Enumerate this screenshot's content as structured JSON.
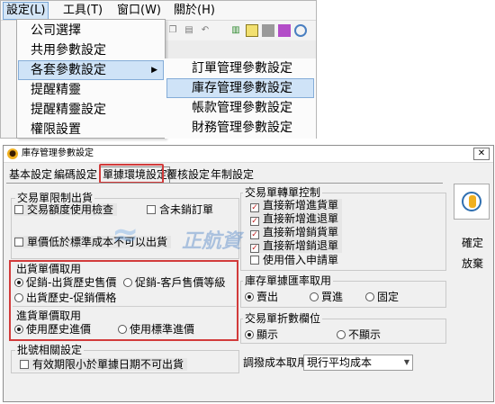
{
  "menubar": {
    "items": [
      {
        "label": "設定(L)"
      },
      {
        "label": "工具(T)"
      },
      {
        "label": "窗口(W)"
      },
      {
        "label": "關於(H)"
      }
    ]
  },
  "settings_menu": {
    "items": [
      {
        "label": "公司選擇"
      },
      {
        "label": "共用參數設定"
      },
      {
        "label": "各套參數設定",
        "arrow": "▶"
      },
      {
        "label": "提醒精靈"
      },
      {
        "label": "提醒精靈設定"
      },
      {
        "label": "權限設置"
      }
    ]
  },
  "submenu": {
    "items": [
      {
        "label": "訂單管理參數設定"
      },
      {
        "label": "庫存管理參數設定"
      },
      {
        "label": "帳款管理參數設定"
      },
      {
        "label": "財務管理參數設定"
      }
    ]
  },
  "dialog": {
    "title": "庫存管理參數設定",
    "close_glyph": "✕",
    "tabs": [
      {
        "label": "基本設定"
      },
      {
        "label": "編碼設定"
      },
      {
        "label": "單據環境設定"
      },
      {
        "label": "覆核設定"
      },
      {
        "label": "年制設定"
      }
    ],
    "left": {
      "trade_limit": {
        "title": "交易單限制出貨",
        "check_amount": "交易額度使用檢查",
        "include_unsettled": "含未銷訂單",
        "price_below_cost": "單價低於標準成本不可以出貨"
      },
      "sales_price": {
        "title": "出貨單價取用",
        "options": [
          {
            "label": "促銷-出貨歷史售價",
            "selected": true
          },
          {
            "label": "促銷-客戶售價等級",
            "selected": false
          },
          {
            "label": "出貨歷史-促銷價格",
            "selected": false
          }
        ]
      },
      "purchase_price": {
        "title": "進貨單價取用",
        "options": [
          {
            "label": "使用歷史進價",
            "selected": true
          },
          {
            "label": "使用標準進價",
            "selected": false
          }
        ]
      },
      "batch": {
        "title": "批號相關設定",
        "expiry_check": "有效期限小於單據日期不可出貨"
      }
    },
    "right": {
      "transfer": {
        "title": "交易單轉單控制",
        "items": [
          {
            "label": "直接新增進貨單",
            "checked": true
          },
          {
            "label": "直接新增進退單",
            "checked": true
          },
          {
            "label": "直接新增銷貨單",
            "checked": true
          },
          {
            "label": "直接新增銷退單",
            "checked": true
          },
          {
            "label": "使用借入申請單",
            "checked": false
          }
        ],
        "check_glyph": "✓"
      },
      "exchange_rate": {
        "title": "庫存單據匯率取用",
        "options": [
          {
            "label": "賣出",
            "selected": true
          },
          {
            "label": "買進",
            "selected": false
          },
          {
            "label": "固定",
            "selected": false
          }
        ]
      },
      "decimal": {
        "title": "交易單折數欄位",
        "options": [
          {
            "label": "顯示",
            "selected": true
          },
          {
            "label": "不顯示",
            "selected": false
          }
        ]
      },
      "cost": {
        "label": "調撥成本取用",
        "value": "現行平均成本",
        "arrow": "▼"
      }
    },
    "buttons": {
      "confirm": "確定",
      "cancel": "放棄"
    }
  },
  "watermark": {
    "text": "正航資"
  },
  "colors": {
    "highlight_red": "#d23b3b",
    "menu_hover": "#cfe3f7"
  }
}
